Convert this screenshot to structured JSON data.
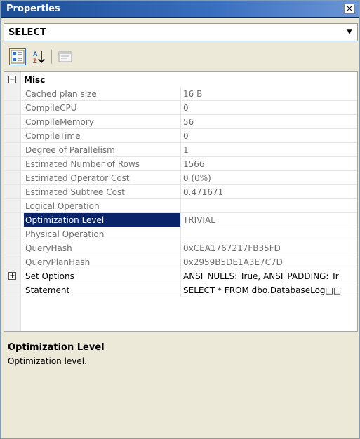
{
  "window": {
    "title": "Properties",
    "close_glyph": "✕"
  },
  "object_selector": {
    "value": "SELECT",
    "arrow_glyph": "▼"
  },
  "toolbar": {
    "buttons": [
      {
        "name": "categorized-icon",
        "active": true
      },
      {
        "name": "alphabetical-icon",
        "active": false
      },
      {
        "name": "property-pages-icon",
        "active": false
      }
    ]
  },
  "grid": {
    "category": {
      "label": "Misc",
      "expander": "−"
    },
    "properties": [
      {
        "name": "Cached plan size",
        "value": "16 B",
        "editable": false,
        "selected": false,
        "expandable": false
      },
      {
        "name": "CompileCPU",
        "value": "0",
        "editable": false,
        "selected": false,
        "expandable": false
      },
      {
        "name": "CompileMemory",
        "value": "56",
        "editable": false,
        "selected": false,
        "expandable": false
      },
      {
        "name": "CompileTime",
        "value": "0",
        "editable": false,
        "selected": false,
        "expandable": false
      },
      {
        "name": "Degree of Parallelism",
        "value": "1",
        "editable": false,
        "selected": false,
        "expandable": false
      },
      {
        "name": "Estimated Number of Rows",
        "value": "1566",
        "editable": false,
        "selected": false,
        "expandable": false
      },
      {
        "name": "Estimated Operator Cost",
        "value": "0 (0%)",
        "editable": false,
        "selected": false,
        "expandable": false
      },
      {
        "name": "Estimated Subtree Cost",
        "value": "0.471671",
        "editable": false,
        "selected": false,
        "expandable": false
      },
      {
        "name": "Logical Operation",
        "value": "",
        "editable": false,
        "selected": false,
        "expandable": false
      },
      {
        "name": "Optimization Level",
        "value": "TRIVIAL",
        "editable": false,
        "selected": true,
        "expandable": false
      },
      {
        "name": "Physical Operation",
        "value": "",
        "editable": false,
        "selected": false,
        "expandable": false
      },
      {
        "name": "QueryHash",
        "value": "0xCEA1767217FB35FD",
        "editable": false,
        "selected": false,
        "expandable": false
      },
      {
        "name": "QueryPlanHash",
        "value": "0x2959B5DE1A3E7C7D",
        "editable": false,
        "selected": false,
        "expandable": false
      },
      {
        "name": "Set Options",
        "value": "ANSI_NULLS: True, ANSI_PADDING: Tr",
        "editable": true,
        "selected": false,
        "expandable": true
      },
      {
        "name": "Statement",
        "value": "SELECT * FROM dbo.DatabaseLog□□",
        "editable": true,
        "selected": false,
        "expandable": false
      }
    ]
  },
  "description": {
    "title": "Optimization Level",
    "text": "Optimization level."
  }
}
